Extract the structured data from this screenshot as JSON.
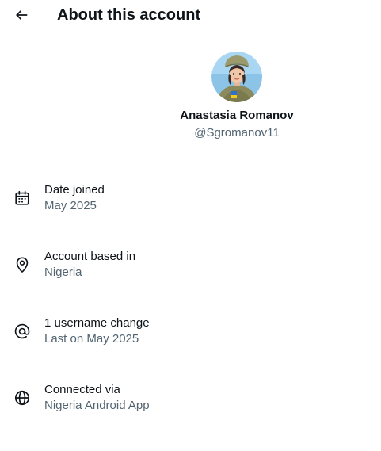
{
  "header": {
    "back_icon": "arrow-left-icon",
    "title": "About this account"
  },
  "profile": {
    "avatar_icon": "profile-avatar",
    "display_name": "Anastasia Romanov",
    "handle": "@Sgromanov11"
  },
  "info": [
    {
      "icon": "calendar-icon",
      "label": "Date joined",
      "value": "May 2025"
    },
    {
      "icon": "location-pin-icon",
      "label": "Account based in",
      "value": "Nigeria"
    },
    {
      "icon": "at-sign-icon",
      "label": "1 username change",
      "value": "Last on May 2025"
    },
    {
      "icon": "globe-icon",
      "label": "Connected via",
      "value": "Nigeria Android App"
    }
  ],
  "colors": {
    "primary_text": "#0f1419",
    "secondary_text": "#536471",
    "background": "#ffffff"
  }
}
